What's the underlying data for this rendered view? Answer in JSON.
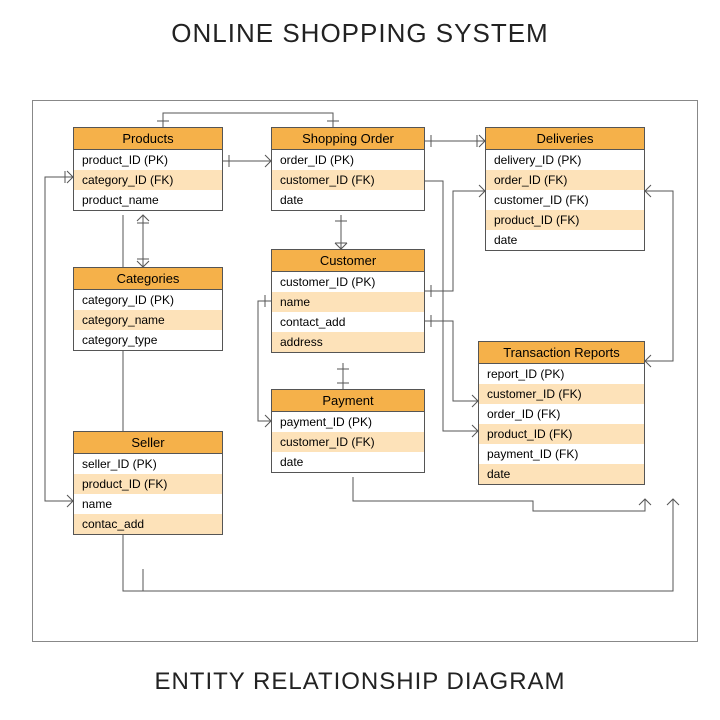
{
  "title": "ONLINE SHOPPING SYSTEM",
  "subtitle": "ENTITY RELATIONSHIP DIAGRAM",
  "entities": {
    "products": {
      "name": "Products",
      "fields": [
        "product_ID (PK)",
        "category_ID (FK)",
        "product_name"
      ]
    },
    "categories": {
      "name": "Categories",
      "fields": [
        "category_ID (PK)",
        "category_name",
        "category_type"
      ]
    },
    "seller": {
      "name": "Seller",
      "fields": [
        "seller_ID (PK)",
        "product_ID (FK)",
        "name",
        "contac_add"
      ]
    },
    "shopping_order": {
      "name": "Shopping Order",
      "fields": [
        "order_ID (PK)",
        "customer_ID (FK)",
        "date"
      ]
    },
    "customer": {
      "name": "Customer",
      "fields": [
        "customer_ID (PK)",
        "name",
        "contact_add",
        "address"
      ]
    },
    "payment": {
      "name": "Payment",
      "fields": [
        "payment_ID (PK)",
        "customer_ID (FK)",
        "date"
      ]
    },
    "deliveries": {
      "name": "Deliveries",
      "fields": [
        "delivery_ID (PK)",
        "order_ID (FK)",
        "customer_ID (FK)",
        "product_ID (FK)",
        "date"
      ]
    },
    "transaction_reports": {
      "name": "Transaction Reports",
      "fields": [
        "report_ID (PK)",
        "customer_ID (FK)",
        "order_ID (FK)",
        "product_ID (FK)",
        "payment_ID (FK)",
        "date"
      ]
    }
  },
  "chart_data": {
    "type": "er-diagram",
    "entities": [
      {
        "name": "Products",
        "attributes": [
          "product_ID (PK)",
          "category_ID (FK)",
          "product_name"
        ]
      },
      {
        "name": "Categories",
        "attributes": [
          "category_ID (PK)",
          "category_name",
          "category_type"
        ]
      },
      {
        "name": "Seller",
        "attributes": [
          "seller_ID (PK)",
          "product_ID (FK)",
          "name",
          "contac_add"
        ]
      },
      {
        "name": "Shopping Order",
        "attributes": [
          "order_ID (PK)",
          "customer_ID (FK)",
          "date"
        ]
      },
      {
        "name": "Customer",
        "attributes": [
          "customer_ID (PK)",
          "name",
          "contact_add",
          "address"
        ]
      },
      {
        "name": "Payment",
        "attributes": [
          "payment_ID (PK)",
          "customer_ID (FK)",
          "date"
        ]
      },
      {
        "name": "Deliveries",
        "attributes": [
          "delivery_ID (PK)",
          "order_ID (FK)",
          "customer_ID (FK)",
          "product_ID (FK)",
          "date"
        ]
      },
      {
        "name": "Transaction Reports",
        "attributes": [
          "report_ID (PK)",
          "customer_ID (FK)",
          "order_ID (FK)",
          "product_ID (FK)",
          "payment_ID (FK)",
          "date"
        ]
      }
    ],
    "relationships": [
      {
        "from": "Products",
        "to": "Categories"
      },
      {
        "from": "Products",
        "to": "Seller"
      },
      {
        "from": "Products",
        "to": "Shopping Order"
      },
      {
        "from": "Shopping Order",
        "to": "Deliveries"
      },
      {
        "from": "Shopping Order",
        "to": "Customer"
      },
      {
        "from": "Customer",
        "to": "Deliveries"
      },
      {
        "from": "Customer",
        "to": "Payment"
      },
      {
        "from": "Customer",
        "to": "Transaction Reports"
      },
      {
        "from": "Payment",
        "to": "Transaction Reports"
      },
      {
        "from": "Shopping Order",
        "to": "Transaction Reports"
      },
      {
        "from": "Products",
        "to": "Transaction Reports"
      },
      {
        "from": "Deliveries",
        "to": "Transaction Reports"
      }
    ]
  }
}
